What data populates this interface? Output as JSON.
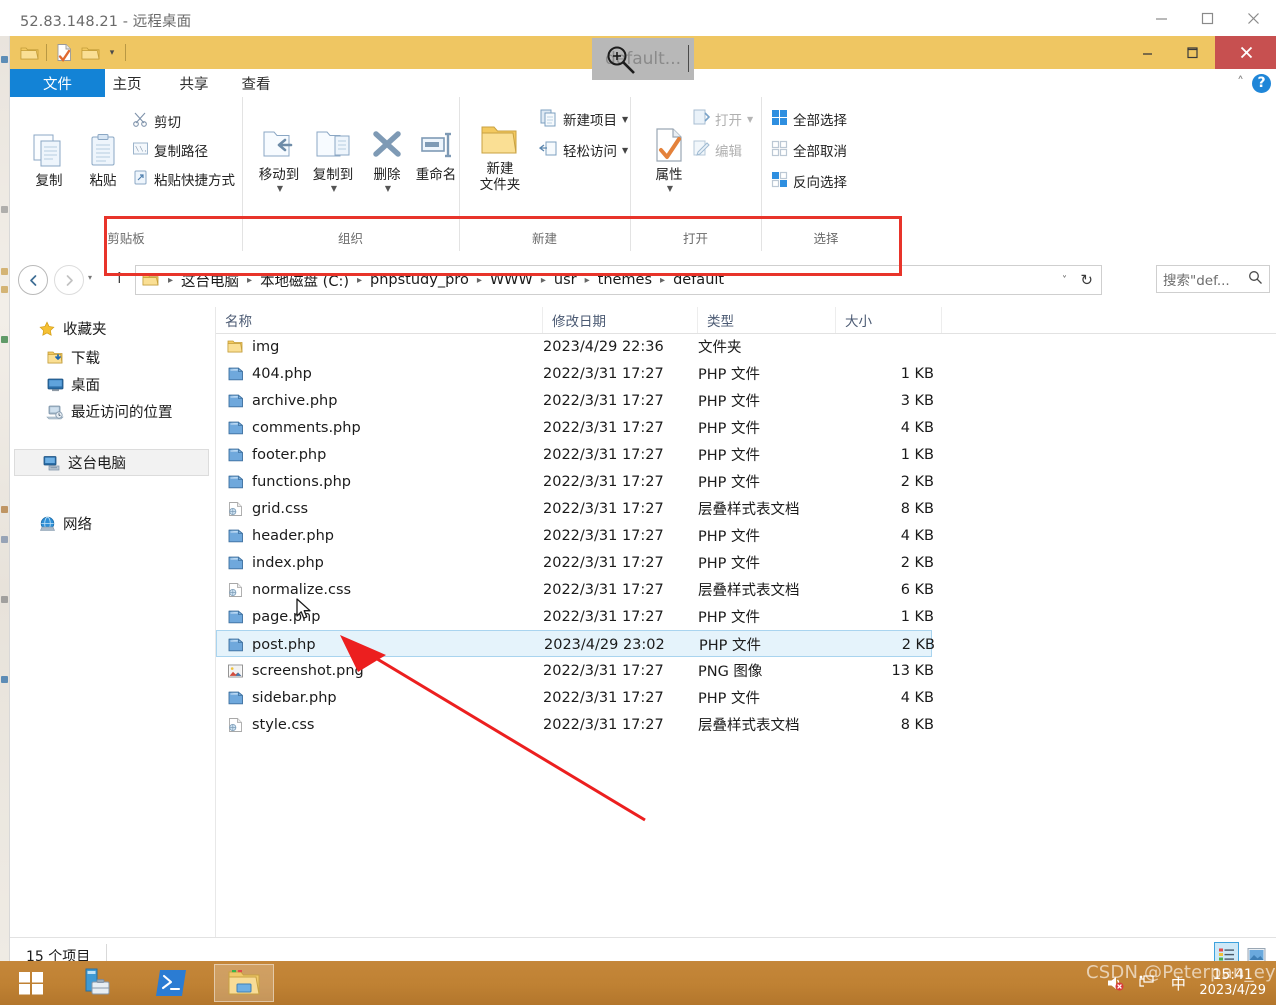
{
  "rdp_window": {
    "title": "52.83.148.21 - 远程桌面",
    "minimize": "—",
    "maximize": "☐",
    "close": "✕"
  },
  "explorer": {
    "quick_access": {
      "icons": [
        "folder-icon",
        "properties-icon",
        "new-folder-icon"
      ],
      "caret": "▾"
    },
    "caption_buttons": {
      "minimize": "—",
      "restore": "❐",
      "close": "✕"
    },
    "hover_tooltip": "default...",
    "tabs": [
      {
        "label": "文件",
        "name": "tab-file"
      },
      {
        "label": "主页",
        "name": "tab-home"
      },
      {
        "label": "共享",
        "name": "tab-share"
      },
      {
        "label": "查看",
        "name": "tab-view"
      }
    ],
    "ribbon_right": {
      "collapse": "˄",
      "help": "?"
    },
    "ribbon": {
      "groups": [
        {
          "label": "剪贴板",
          "big_buttons": [
            {
              "label": "复制",
              "icon": "copy-icon"
            },
            {
              "label": "粘贴",
              "icon": "paste-icon"
            }
          ],
          "small_buttons": [
            {
              "label": "剪切",
              "icon": "scissors-icon"
            },
            {
              "label": "复制路径",
              "icon": "copy-path-icon"
            },
            {
              "label": "粘贴快捷方式",
              "icon": "paste-shortcut-icon"
            }
          ]
        },
        {
          "label": "组织",
          "big_buttons": [
            {
              "label": "移动到",
              "icon": "move-to-icon",
              "has_caret": true
            },
            {
              "label": "复制到",
              "icon": "copy-to-icon",
              "has_caret": true
            },
            {
              "label": "删除",
              "icon": "delete-icon",
              "has_caret": true
            },
            {
              "label": "重命名",
              "icon": "rename-icon"
            }
          ],
          "small_buttons": []
        },
        {
          "label": "新建",
          "big_buttons": [
            {
              "label": "新建\n文件夹",
              "icon": "new-folder-icon"
            }
          ],
          "small_buttons": [
            {
              "label": "新建项目",
              "icon": "new-item-icon",
              "has_caret": true
            },
            {
              "label": "轻松访问",
              "icon": "easy-access-icon",
              "has_caret": true
            }
          ]
        },
        {
          "label": "打开",
          "big_buttons": [
            {
              "label": "属性",
              "icon": "properties-icon",
              "has_caret": true
            }
          ],
          "small_buttons": [
            {
              "label": "打开",
              "icon": "open-icon",
              "has_caret": true,
              "disabled": true
            },
            {
              "label": "编辑",
              "icon": "edit-icon",
              "disabled": true
            }
          ]
        },
        {
          "label": "选择",
          "big_buttons": [],
          "small_buttons": [
            {
              "label": "全部选择",
              "icon": "select-all-icon"
            },
            {
              "label": "全部取消",
              "icon": "select-none-icon"
            },
            {
              "label": "反向选择",
              "icon": "invert-selection-icon"
            }
          ]
        }
      ]
    },
    "address_bar": {
      "back": "back-arrow-icon",
      "forward": "forward-arrow-icon",
      "history": "▾",
      "up": "↑",
      "breadcrumbs": [
        "这台电脑",
        "本地磁盘 (C:)",
        "phpstudy_pro",
        "WWW",
        "usr",
        "themes",
        "default"
      ],
      "separator": "▸",
      "dropdown": "˅",
      "refresh": "↻"
    },
    "search": {
      "placeholder": "搜索\"def...",
      "icon": "search-icon"
    },
    "nav_pane": [
      {
        "label": "收藏夹",
        "icon": "star-icon",
        "indent": false,
        "selected": false
      },
      {
        "label": "下载",
        "icon": "downloads-folder-icon",
        "indent": true,
        "selected": false
      },
      {
        "label": "桌面",
        "icon": "desktop-icon",
        "indent": true,
        "selected": false
      },
      {
        "label": "最近访问的位置",
        "icon": "recent-places-icon",
        "indent": true,
        "selected": false
      },
      {
        "label": "这台电脑",
        "icon": "this-pc-icon",
        "indent": false,
        "selected": true
      },
      {
        "label": "网络",
        "icon": "network-icon",
        "indent": false,
        "selected": false
      }
    ],
    "columns": [
      "名称",
      "修改日期",
      "类型",
      "大小"
    ],
    "files": [
      {
        "name": "img",
        "date": "2023/4/29 22:36",
        "type": "文件夹",
        "size": "",
        "icon": "folder-icon",
        "selected": false
      },
      {
        "name": "404.php",
        "date": "2022/3/31 17:27",
        "type": "PHP 文件",
        "size": "1 KB",
        "icon": "php-file-icon",
        "selected": false
      },
      {
        "name": "archive.php",
        "date": "2022/3/31 17:27",
        "type": "PHP 文件",
        "size": "3 KB",
        "icon": "php-file-icon",
        "selected": false
      },
      {
        "name": "comments.php",
        "date": "2022/3/31 17:27",
        "type": "PHP 文件",
        "size": "4 KB",
        "icon": "php-file-icon",
        "selected": false
      },
      {
        "name": "footer.php",
        "date": "2022/3/31 17:27",
        "type": "PHP 文件",
        "size": "1 KB",
        "icon": "php-file-icon",
        "selected": false
      },
      {
        "name": "functions.php",
        "date": "2022/3/31 17:27",
        "type": "PHP 文件",
        "size": "2 KB",
        "icon": "php-file-icon",
        "selected": false
      },
      {
        "name": "grid.css",
        "date": "2022/3/31 17:27",
        "type": "层叠样式表文档",
        "size": "8 KB",
        "icon": "css-file-icon",
        "selected": false
      },
      {
        "name": "header.php",
        "date": "2022/3/31 17:27",
        "type": "PHP 文件",
        "size": "4 KB",
        "icon": "php-file-icon",
        "selected": false
      },
      {
        "name": "index.php",
        "date": "2022/3/31 17:27",
        "type": "PHP 文件",
        "size": "2 KB",
        "icon": "php-file-icon",
        "selected": false
      },
      {
        "name": "normalize.css",
        "date": "2022/3/31 17:27",
        "type": "层叠样式表文档",
        "size": "6 KB",
        "icon": "css-file-icon",
        "selected": false
      },
      {
        "name": "page.php",
        "date": "2022/3/31 17:27",
        "type": "PHP 文件",
        "size": "1 KB",
        "icon": "php-file-icon",
        "selected": false
      },
      {
        "name": "post.php",
        "date": "2023/4/29 23:02",
        "type": "PHP 文件",
        "size": "2 KB",
        "icon": "php-file-icon",
        "selected": true
      },
      {
        "name": "screenshot.png",
        "date": "2022/3/31 17:27",
        "type": "PNG 图像",
        "size": "13 KB",
        "icon": "png-file-icon",
        "selected": false
      },
      {
        "name": "sidebar.php",
        "date": "2022/3/31 17:27",
        "type": "PHP 文件",
        "size": "4 KB",
        "icon": "php-file-icon",
        "selected": false
      },
      {
        "name": "style.css",
        "date": "2022/3/31 17:27",
        "type": "层叠样式表文档",
        "size": "8 KB",
        "icon": "css-file-icon",
        "selected": false
      }
    ],
    "status": {
      "item_count": "15 个项目",
      "view_details": "details-view-icon",
      "view_large": "large-icons-view-icon"
    }
  },
  "taskbar": {
    "start": "windows-start-icon",
    "items": [
      {
        "name": "server-manager-icon",
        "active": false
      },
      {
        "name": "powershell-icon",
        "active": false
      },
      {
        "name": "file-explorer-icon",
        "active": true
      }
    ],
    "tray": {
      "volume": "volume-muted-icon",
      "network": "network-icon",
      "ime": "中",
      "time": "15:41",
      "date": "2023/4/29"
    }
  },
  "annotations": {
    "watermark": "CSDN @Peterpan_eye",
    "highlight_color": "#e8342a"
  },
  "colors": {
    "caption_yellow": "#efc662",
    "tab_blue": "#1383d6",
    "close_red": "#c75050",
    "selection_blue": "#e5f3fb",
    "taskbar_brown": "#bf8133"
  }
}
